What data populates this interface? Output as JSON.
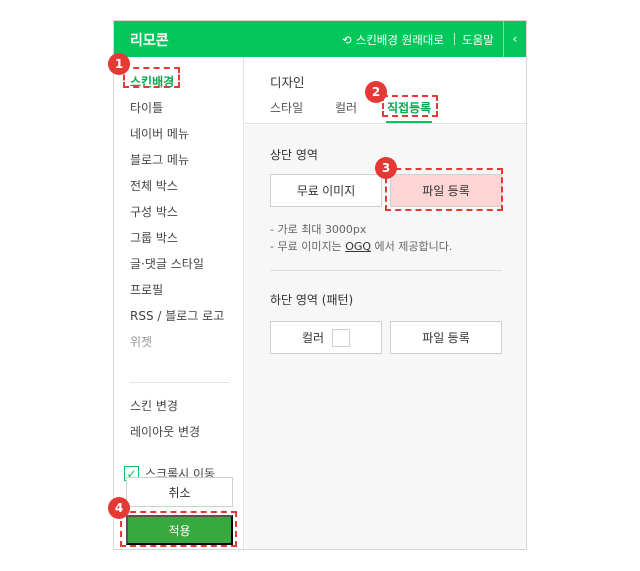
{
  "header": {
    "title": "리모콘",
    "revert_label": "스킨배경 원래대로",
    "help_label": "도움말",
    "collapse_glyph": "‹"
  },
  "sidebar": {
    "items": [
      {
        "label": "스킨배경",
        "active": true
      },
      {
        "label": "타이틀"
      },
      {
        "label": "네이버 메뉴"
      },
      {
        "label": "블로그 메뉴"
      },
      {
        "label": "전체 박스"
      },
      {
        "label": "구성 박스"
      },
      {
        "label": "그룹 박스"
      },
      {
        "label": "글·댓글 스타일"
      },
      {
        "label": "프로필"
      },
      {
        "label": "RSS / 블로그 로고"
      },
      {
        "label": "위젯",
        "dim": true
      }
    ],
    "extra_items": [
      {
        "label": "스킨 변경"
      },
      {
        "label": "레이아웃 변경"
      }
    ],
    "scroll_move_label": "스크롤시 이동",
    "scroll_move_checked": true,
    "cancel_label": "취소",
    "apply_label": "적용"
  },
  "main": {
    "section_title": "디자인",
    "tabs": [
      {
        "label": "스타일"
      },
      {
        "label": "컬러"
      },
      {
        "label": "직접등록",
        "active": true
      }
    ],
    "top_area_label": "상단 영역",
    "free_image_label": "무료 이미지",
    "file_register_label": "파일 등록",
    "note_1": "- 가로 최대 3000px",
    "note_2_prefix": "- 무료 이미지는 ",
    "note_2_link": "OGQ",
    "note_2_suffix": " 에서 제공합니다.",
    "bottom_area_label": "하단 영역 (패턴)",
    "color_label": "컬러",
    "bottom_file_register_label": "파일 등록"
  },
  "annotations": [
    "1",
    "2",
    "3",
    "4"
  ],
  "colors": {
    "brand_green": "#03c75a",
    "apply_green": "#36a93f",
    "annotation_red": "#e53935",
    "highlight_pink": "#fdd5d5"
  }
}
